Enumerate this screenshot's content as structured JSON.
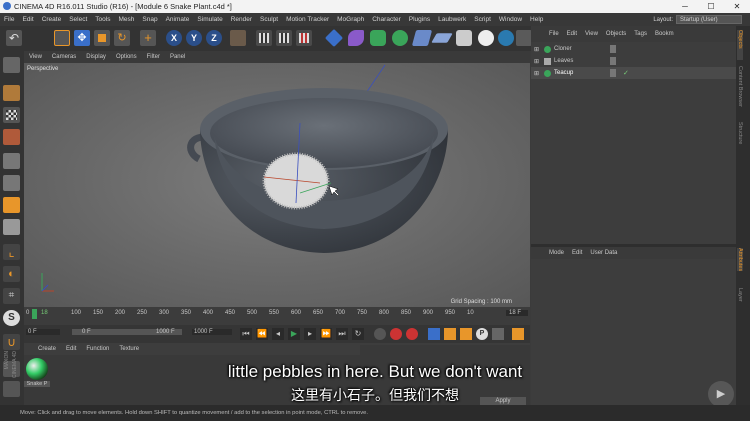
{
  "window": {
    "title": "CINEMA 4D R16.011 Studio (R16) - [Module 6 Snake Plant.c4d *]",
    "minimize": "─",
    "maximize": "☐",
    "close": "✕"
  },
  "menubar": {
    "items": [
      "File",
      "Edit",
      "Create",
      "Select",
      "Tools",
      "Mesh",
      "Snap",
      "Animate",
      "Simulate",
      "Render",
      "Sculpt",
      "Motion Tracker",
      "MoGraph",
      "Character",
      "Plugins",
      "Laubwerk",
      "Script",
      "Window",
      "Help"
    ],
    "layout_label": "Layout:",
    "layout_value": "Startup (User)"
  },
  "viewport": {
    "menu": [
      "View",
      "Cameras",
      "Display",
      "Options",
      "Filter",
      "Panel"
    ],
    "label": "Perspective",
    "grid_spacing": "Grid Spacing : 100 mm"
  },
  "timeline": {
    "ticks": [
      "0",
      "18",
      "100",
      "150",
      "200",
      "250",
      "300",
      "350",
      "400",
      "450",
      "500",
      "550",
      "600",
      "650",
      "700",
      "750",
      "800",
      "850",
      "900",
      "950",
      "10"
    ],
    "end_frame": "18 F"
  },
  "transport": {
    "start_field": "0 F",
    "min_field": "0 F",
    "max_field": "1000 F",
    "end_field": "1000 F"
  },
  "material_manager": {
    "menu": [
      "Create",
      "Edit",
      "Function",
      "Texture"
    ],
    "material_name": "Snake P"
  },
  "object_manager": {
    "menu": [
      "File",
      "Edit",
      "View",
      "Objects",
      "Tags",
      "Bookm"
    ],
    "objects": [
      "Cloner",
      "Leaves",
      "Teacup"
    ]
  },
  "attribute_manager": {
    "menu": [
      "Mode",
      "Edit",
      "User Data"
    ],
    "apply": "Apply"
  },
  "side_tabs": {
    "right": [
      "Objects",
      "Content Browser",
      "Structure",
      "Attributes",
      "Layer"
    ],
    "left": [
      "MAXON",
      "CINEMA 4D"
    ]
  },
  "status": {
    "text": "Move: Click and drag to move elements. Hold down SHIFT to quantize movement / add to the selection in point mode, CTRL to remove."
  },
  "subtitles": {
    "english": "little pebbles in here. But we don't want",
    "chinese": "这里有小石子。但我们不想"
  },
  "colors": {
    "accent_orange": "#e8962a",
    "accent_blue": "#3a6fc9"
  }
}
